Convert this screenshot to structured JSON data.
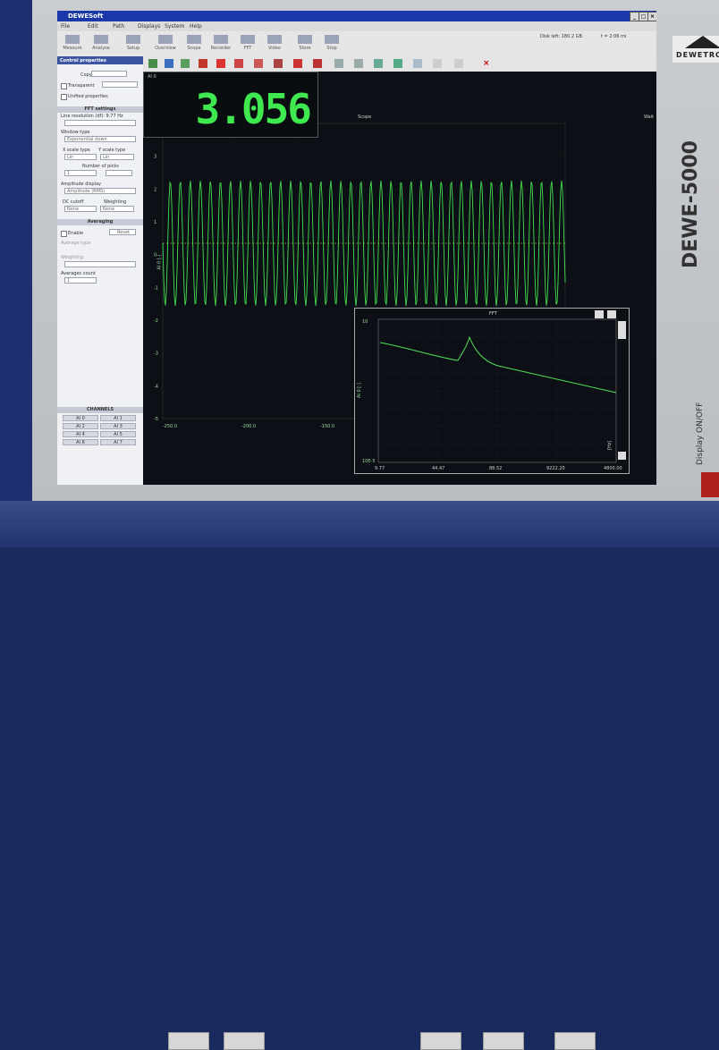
{
  "window": {
    "title": "DEWESoft",
    "controls": [
      "_",
      "□",
      "×"
    ]
  },
  "menu": [
    "File",
    "Edit",
    "Path",
    "Displays",
    "System",
    "Help"
  ],
  "toolbar": [
    {
      "label": "Measure",
      "icon": "measure-icon"
    },
    {
      "label": "Analyse",
      "icon": "analyse-icon"
    },
    {
      "label": "Setup",
      "icon": "setup-icon"
    },
    {
      "label": "Overview",
      "icon": "overview-icon"
    },
    {
      "label": "Scope",
      "icon": "scope-icon"
    },
    {
      "label": "Recorder",
      "icon": "recorder-icon"
    },
    {
      "label": "FFT",
      "icon": "fft-icon"
    },
    {
      "label": "Video",
      "icon": "video-icon"
    },
    {
      "label": "Store",
      "icon": "store-icon"
    },
    {
      "label": "Stop",
      "icon": "stop-icon"
    }
  ],
  "status": {
    "disk_left": "Disk left: 180.2 GB",
    "time_left": "t = 2:06 mi"
  },
  "panel": {
    "header": "Control properties",
    "copy_label": "Copy",
    "transparent_label": "Transparent",
    "unified_label": "Unified properties",
    "fft_section": "FFT settings",
    "line_resolution_label": "Line resolution (df): 9.77 Hz",
    "window_label": "Window type",
    "window_value": "Exponential down",
    "xscale_label": "X scale type",
    "yscale_label": "Y scale type",
    "xscale_value": "Lin",
    "yscale_value": "Lin",
    "picks_label": "Number of picks",
    "picks_value": "1",
    "amp_label": "Amplitude display",
    "amp_value": "Amplitude (RMS)",
    "dc_label": "DC cutoff",
    "weight_label": "Weighting",
    "dc_value": "None",
    "weight_value": "None",
    "averaging_section": "Averaging",
    "enable_label": "Enable",
    "reset_label": "Reset",
    "avg_type_label": "Average type",
    "weighting_label": "Weighting",
    "avg_count_label": "Averages count",
    "avg_count_value": "1",
    "channels_section": "CHANNELS",
    "channels": [
      "AI 0",
      "AI 1",
      "AI 2",
      "AI 3",
      "AI 4",
      "AI 5",
      "AI 6",
      "AI 7"
    ]
  },
  "meter": {
    "caption": "AI 0",
    "value": "3.056"
  },
  "scope": {
    "title": "Scope",
    "right_label": "Wait",
    "ylabel": "AI 0 [-]",
    "x_ticks": [
      "-250.0",
      "-200.0",
      "-150.0",
      "-100.0",
      "-50.0"
    ],
    "y_ticks": [
      "4",
      "3",
      "2",
      "1",
      "0",
      "-1",
      "-2",
      "-3",
      "-4",
      "-5"
    ]
  },
  "fft": {
    "title": "FFT",
    "ylabel": "AI 0 [-]",
    "y_top": "10",
    "y_bottom": "10E-5",
    "x_ticks": [
      "9.77",
      "44.47",
      "88.52",
      "9222.20",
      "4800.00"
    ],
    "x_unit": "[Hz]"
  },
  "device": {
    "brand": "DEWETRON",
    "model": "DEWE-5000",
    "side_label": "Display ON/OFF"
  },
  "colors": {
    "signal": "#3ee84e",
    "screen_bg": "#0c0f16",
    "window_blue": "#1c2f8a"
  }
}
